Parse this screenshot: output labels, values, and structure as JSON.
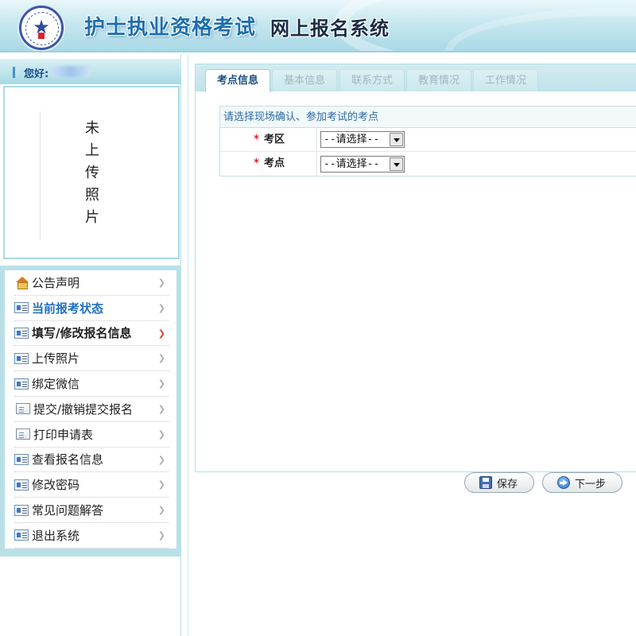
{
  "header": {
    "title": "护士执业资格考试",
    "subtitle": "网上报名系统",
    "logo_icon": "nurse-exam-emblem-icon"
  },
  "sidebar": {
    "greeting": "您好:",
    "photo_placeholder": "未上传照片",
    "menu": [
      {
        "label": "公告声明",
        "icon": "home-icon",
        "style": "normal"
      },
      {
        "label": "当前报考状态",
        "icon": "card-icon",
        "style": "blue-bold"
      },
      {
        "label": "填写/修改报名信息",
        "icon": "card-icon",
        "style": "bold",
        "active_arrow": true
      },
      {
        "label": "上传照片",
        "icon": "card-icon",
        "style": "normal"
      },
      {
        "label": "绑定微信",
        "icon": "card-icon",
        "style": "normal"
      },
      {
        "label": "提交/撤销提交报名",
        "icon": "page-icon",
        "style": "normal"
      },
      {
        "label": "打印申请表",
        "icon": "page-icon",
        "style": "normal"
      },
      {
        "label": "查看报名信息",
        "icon": "card-icon",
        "style": "normal"
      },
      {
        "label": "修改密码",
        "icon": "card-icon",
        "style": "normal"
      },
      {
        "label": "常见问题解答",
        "icon": "card-icon",
        "style": "normal"
      },
      {
        "label": "退出系统",
        "icon": "card-icon",
        "style": "normal"
      }
    ]
  },
  "tabs": [
    {
      "label": "考点信息",
      "active": true
    },
    {
      "label": "基本信息",
      "active": false
    },
    {
      "label": "联系方式",
      "active": false
    },
    {
      "label": "教育情况",
      "active": false
    },
    {
      "label": "工作情况",
      "active": false
    }
  ],
  "form": {
    "instruction": "请选择现场确认、参加考试的考点",
    "fields": [
      {
        "label": "考区",
        "required_mark": "*",
        "value": "--请选择--"
      },
      {
        "label": "考点",
        "required_mark": "*",
        "value": "--请选择--"
      }
    ]
  },
  "actions": {
    "save_label": "保存",
    "next_label": "下一步"
  },
  "colors": {
    "header_bg": "#c6e7ef",
    "title_blue": "#1d6fb0",
    "active_tab_text": "#1a4f86",
    "required": "#e0202a",
    "sidebar_frame": "#b9e0e7"
  }
}
